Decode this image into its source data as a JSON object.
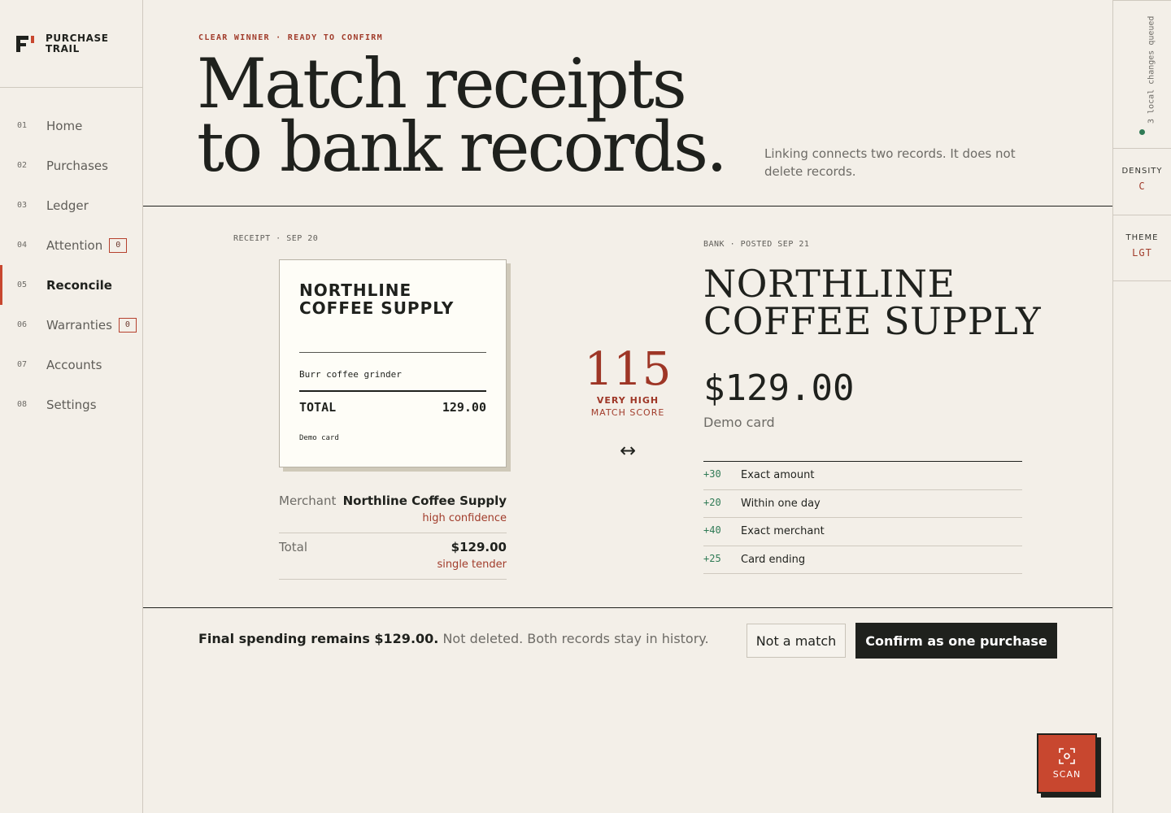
{
  "app": {
    "brand_line1": "PURCHASE",
    "brand_line2": "TRAIL"
  },
  "nav": [
    {
      "num": "01",
      "label": "Home",
      "badge": null,
      "active": false
    },
    {
      "num": "02",
      "label": "Purchases",
      "badge": null,
      "active": false
    },
    {
      "num": "03",
      "label": "Ledger",
      "badge": null,
      "active": false
    },
    {
      "num": "04",
      "label": "Attention",
      "badge": "0",
      "active": false
    },
    {
      "num": "05",
      "label": "Reconcile",
      "badge": null,
      "active": true
    },
    {
      "num": "06",
      "label": "Warranties",
      "badge": "0",
      "active": false
    },
    {
      "num": "07",
      "label": "Accounts",
      "badge": null,
      "active": false
    },
    {
      "num": "08",
      "label": "Settings",
      "badge": null,
      "active": false
    }
  ],
  "hero": {
    "eyebrow": "CLEAR WINNER · READY TO CONFIRM",
    "title_line1": "Match receipts",
    "title_line2": "to bank records.",
    "note": "Linking connects two records. It does not delete records."
  },
  "receipt": {
    "label": "RECEIPT · SEP 20",
    "merchant": "NORTHLINE COFFEE SUPPLY",
    "item": "Burr coffee grinder",
    "total_label": "TOTAL",
    "total_value": "129.00",
    "card": "Demo card"
  },
  "extracted": {
    "merchant_key": "Merchant",
    "merchant_value": "Northline Coffee Supply",
    "merchant_conf": "high confidence",
    "total_key": "Total",
    "total_value": "$129.00",
    "total_conf": "single tender"
  },
  "score": {
    "value": "115",
    "level": "VERY HIGH",
    "caption": "MATCH SCORE",
    "link_symbol": "↔"
  },
  "bank": {
    "label": "BANK · POSTED SEP 21",
    "merchant_line1": "NORTHLINE",
    "merchant_line2": "COFFEE SUPPLY",
    "amount": "$129.00",
    "card": "Demo card",
    "reasons": [
      {
        "points": "+30",
        "text": "Exact amount"
      },
      {
        "points": "+20",
        "text": "Within one day"
      },
      {
        "points": "+40",
        "text": "Exact merchant"
      },
      {
        "points": "+25",
        "text": "Card ending"
      }
    ]
  },
  "actions": {
    "summary_strong": "Final spending remains $129.00.",
    "summary_rest": " Not deleted. Both records stay in history.",
    "reject_label": "Not a match",
    "confirm_label": "Confirm as one purchase"
  },
  "rail": {
    "sync_text": "3 local changes queued",
    "density_key": "DENSITY",
    "density_value": "C",
    "theme_key": "THEME",
    "theme_value": "LGT"
  },
  "scan": {
    "label": "SCAN",
    "icon": "scan-icon"
  },
  "colors": {
    "accent": "#c8472f",
    "ink": "#1f211d",
    "paper": "#f3efe8",
    "positive": "#2f7a55",
    "score": "#9e3626"
  }
}
